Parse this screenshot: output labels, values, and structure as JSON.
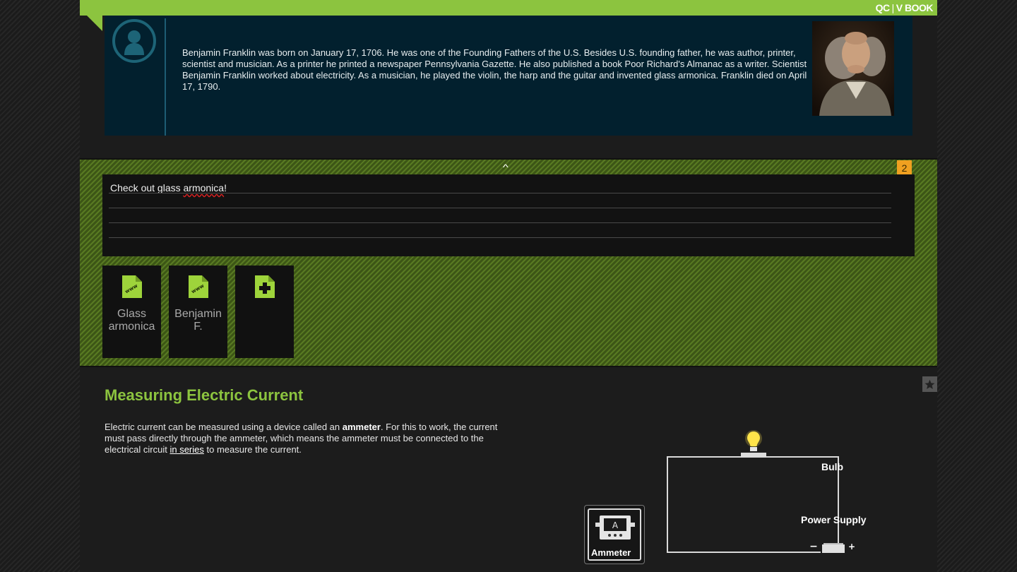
{
  "brand": {
    "left": "QC",
    "right": "V BOOK"
  },
  "bio": {
    "text": "Benjamin Franklin was born on January 17, 1706. He was one of the Founding Fathers of the U.S. Besides U.S. founding father, he was author, printer, scientist and musician. As a printer he printed a newspaper Pennsylvania Gazette. He also published a book Poor Richard's Almanac as a writer. Scientist Benjamin Franklin worked about electricity. As a musician, he played the violin, the harp and the guitar and invented glass armonica. Franklin died on April 17, 1790."
  },
  "notes": {
    "badge_count": "2",
    "line_before": "Check out glass ",
    "misspelled_word": "armonica",
    "line_after": "!"
  },
  "links": [
    {
      "icon": "www-file-icon",
      "label": "Glass armonica"
    },
    {
      "icon": "www-file-icon",
      "label": "Benjamin F."
    },
    {
      "icon": "add-file-icon",
      "label": ""
    }
  ],
  "lesson": {
    "title": "Measuring Electric Current",
    "text_1": "Electric current can be measured using a device called an ",
    "term": "ammeter",
    "text_2": ". For this to work, the current must pass directly through the ammeter, which means the ammeter must be connected to the electrical circuit ",
    "link": "in series",
    "text_3": " to measure the current."
  },
  "circuit": {
    "bulb_label": "Bulb",
    "power_label": "Power Supply",
    "ammeter_label": "Ammeter",
    "ammeter_symbol": "A",
    "minus": "−",
    "plus": "+"
  },
  "colors": {
    "accent": "#8cc43f",
    "bio_bg": "#02202e",
    "badge": "#f0a020",
    "bulb": "#ffe44a"
  }
}
